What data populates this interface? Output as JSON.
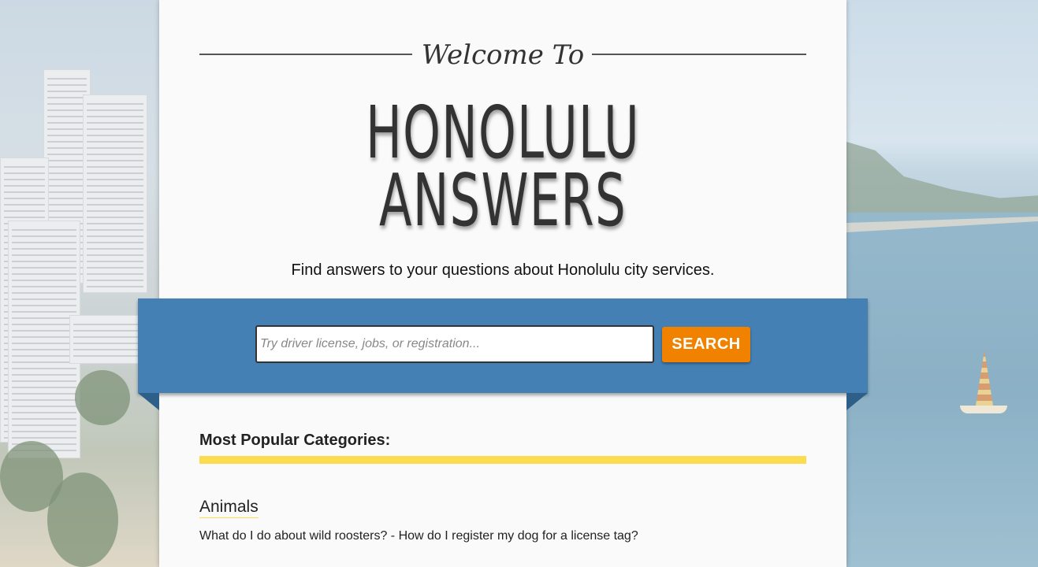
{
  "hero": {
    "welcome": "Welcome To",
    "title_line1": "HONOLULU",
    "title_line2": "ANSWERS",
    "tagline": "Find answers to your questions about Honolulu city services."
  },
  "search": {
    "placeholder": "Try driver license, jobs, or registration...",
    "value": "",
    "button_label": "SEARCH"
  },
  "categories": {
    "heading": "Most Popular Categories:",
    "items": [
      {
        "title": "Animals",
        "questions": [
          "What do I do about wild roosters?",
          "How do I register my dog for a license tag?"
        ],
        "separator": " - "
      }
    ]
  },
  "colors": {
    "ribbon": "#4580b4",
    "search_button": "#f08200",
    "accent_bar": "#fbdc50",
    "panel": "#fafafa"
  }
}
